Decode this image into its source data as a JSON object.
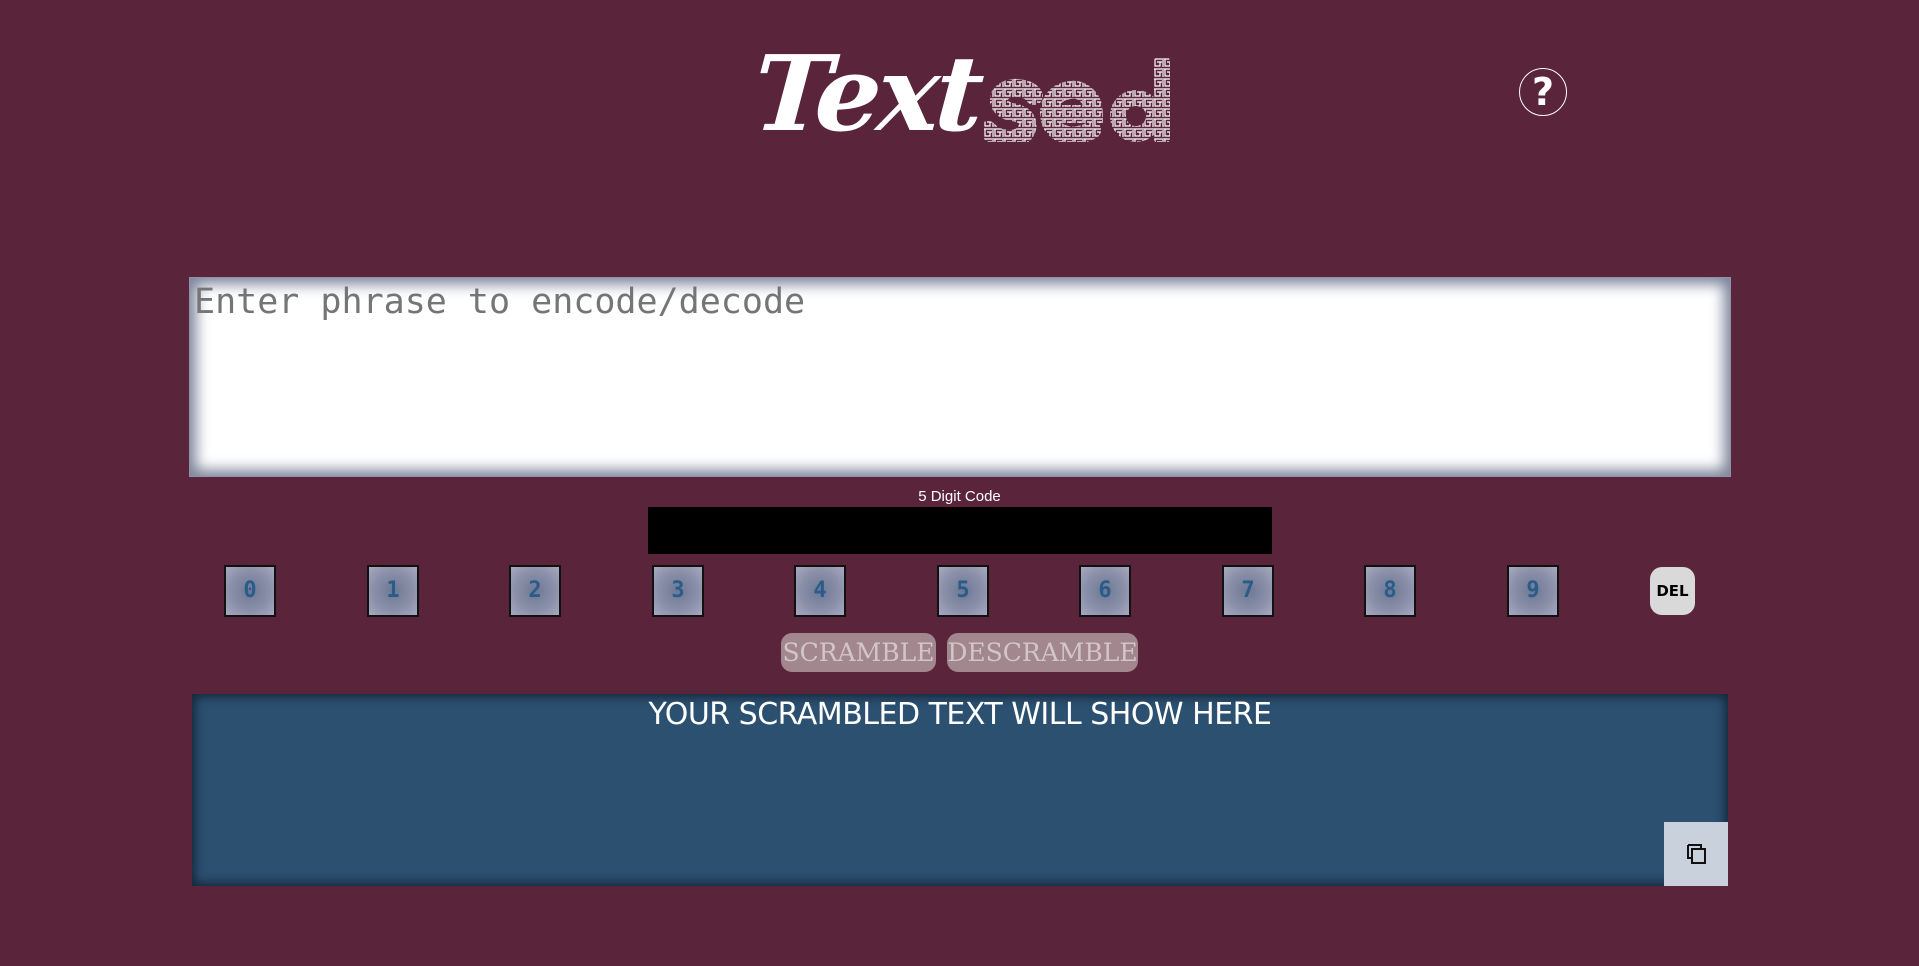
{
  "header": {
    "logo_text": "Text",
    "logo_maze_text": "sed",
    "help_label": "?"
  },
  "input": {
    "placeholder": "Enter phrase to encode/decode",
    "value": ""
  },
  "code": {
    "label": "5 Digit Code",
    "value": ""
  },
  "keypad": {
    "digits": [
      "0",
      "1",
      "2",
      "3",
      "4",
      "5",
      "6",
      "7",
      "8",
      "9"
    ],
    "delete_label": "DEL"
  },
  "actions": {
    "scramble_label": "SCRAMBLE",
    "descramble_label": "DESCRAMBLE"
  },
  "output": {
    "placeholder_text": "YOUR SCRAMBLED TEXT WILL SHOW HERE",
    "copy_icon": "copy-icon"
  },
  "colors": {
    "background": "#5a243b",
    "output_background": "#2c5070",
    "digit_text": "#2a5c8a"
  }
}
